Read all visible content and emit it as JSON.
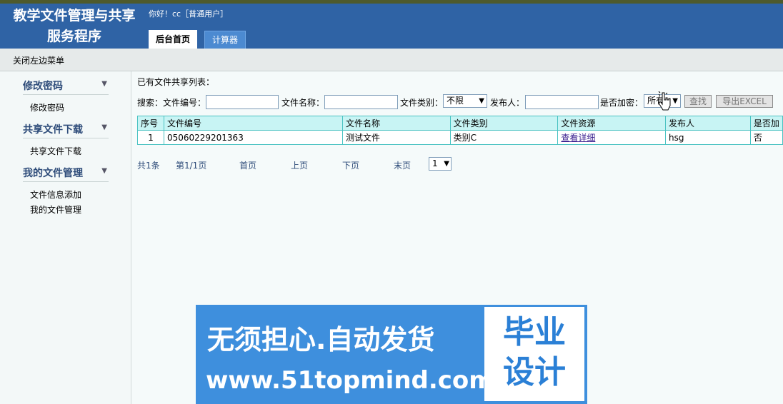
{
  "header": {
    "app_title": "教学文件管理与共享服务程序",
    "greeting": "你好！cc［普通用户］",
    "tabs": [
      {
        "label": "后台首页",
        "active": true
      },
      {
        "label": "计算器",
        "active": false
      }
    ]
  },
  "subbar": {
    "close_menu_label": "关闭左边菜单"
  },
  "sidebar": {
    "groups": [
      {
        "title": "修改密码",
        "items": [
          "修改密码"
        ]
      },
      {
        "title": "共享文件下载",
        "items": [
          "共享文件下载"
        ]
      },
      {
        "title": "我的文件管理",
        "items": [
          "文件信息添加",
          "我的文件管理"
        ]
      }
    ]
  },
  "main": {
    "list_title": "已有文件共享列表：",
    "search": {
      "label": "搜索：",
      "file_no_label": "文件编号：",
      "file_no_value": "",
      "file_name_label": "文件名称：",
      "file_name_value": "",
      "file_type_label": "文件类别：",
      "file_type_selected": "不限",
      "publisher_label": "发布人：",
      "publisher_value": "",
      "encrypted_label": "是否加密：",
      "encrypted_selected": "所有",
      "search_button": "查找",
      "export_button": "导出EXCEL"
    },
    "table": {
      "columns": [
        "序号",
        "文件编号",
        "文件名称",
        "文件类别",
        "文件资源",
        "发布人",
        "是否加"
      ],
      "rows": [
        [
          "1",
          "05060229201363",
          "测试文件",
          "类别C",
          "查看详细",
          "hsg",
          "否"
        ]
      ]
    },
    "pager": {
      "total": "共1条",
      "page_info": "第1/1页",
      "first": "首页",
      "prev": "上页",
      "next": "下页",
      "last": "末页",
      "page_select": "1"
    }
  },
  "banner": {
    "line1": "无须担心.自动发货",
    "line2": "www.51topmind.com",
    "box_text": "毕业设计"
  },
  "colors": {
    "header_bg": "#2f63a5",
    "table_header_bg": "#c8f4f4",
    "table_border": "#49c2c2",
    "banner_bg": "#3e8fdd"
  }
}
